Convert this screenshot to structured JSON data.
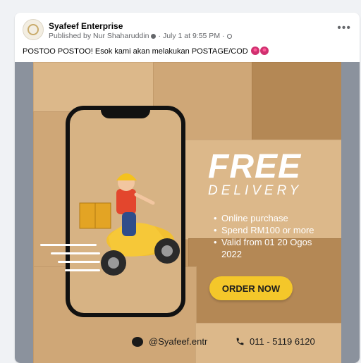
{
  "post": {
    "page_name": "Syafeef Enterprise",
    "published_by": "Published by Nur Shaharuddin",
    "date": "July 1 at 9:55 PM",
    "caption": "POSTOO POSTOO! Esok kami akan melakukan POSTAGE/COD",
    "more_label": "•••"
  },
  "ad": {
    "title": "FREE",
    "subtitle": "DELIVERY",
    "bullets": [
      "Online purchase",
      "Spend RM100 or more",
      "Valid from 01 20 Ogos",
      "2022"
    ],
    "cta": "ORDER NOW",
    "social_handle": "@Syafeef.entr",
    "phone": "011 - 5119 6120"
  },
  "colors": {
    "accent_yellow": "#f4c72a",
    "box_brown": "#c59a66"
  }
}
